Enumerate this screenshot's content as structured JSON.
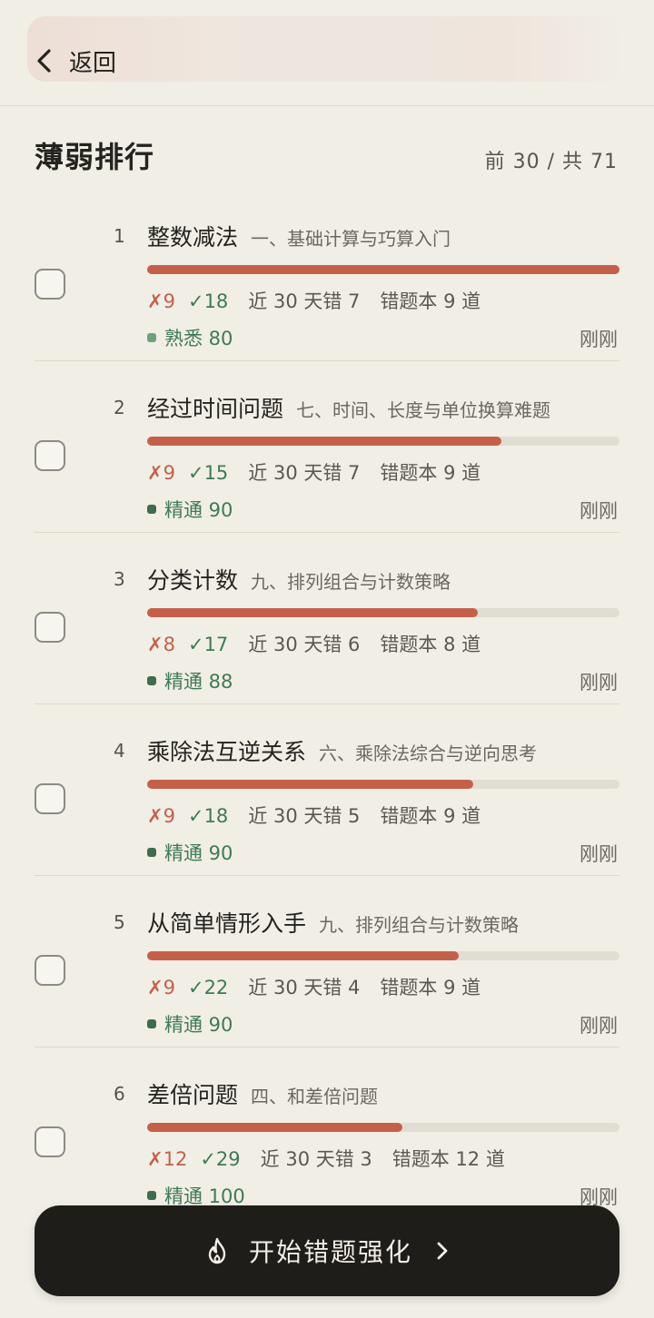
{
  "header": {
    "back_label": "返回"
  },
  "list": {
    "title": "薄弱排行",
    "count_label": "前 30 / 共 71"
  },
  "colors": {
    "accent": "#c4604a",
    "mastery_light": "#6ba37c",
    "mastery_dark": "#3f6b4f",
    "button_bg": "#1f1d1a"
  },
  "items": [
    {
      "rank": "1",
      "name": "整数减法",
      "category": "一、基础计算与巧算入门",
      "progress": 1.0,
      "wrong": "✗9",
      "right": "✓18",
      "recent": "近 30 天错 7",
      "book": "错题本 9 道",
      "mastery": "熟悉 80",
      "mastery_level": "light",
      "time": "刚刚"
    },
    {
      "rank": "2",
      "name": "经过时间问题",
      "category": "七、时间、长度与单位换算难题",
      "progress": 0.75,
      "wrong": "✗9",
      "right": "✓15",
      "recent": "近 30 天错 7",
      "book": "错题本 9 道",
      "mastery": "精通 90",
      "mastery_level": "dark",
      "time": "刚刚"
    },
    {
      "rank": "3",
      "name": "分类计数",
      "category": "九、排列组合与计数策略",
      "progress": 0.7,
      "wrong": "✗8",
      "right": "✓17",
      "recent": "近 30 天错 6",
      "book": "错题本 8 道",
      "mastery": "精通 88",
      "mastery_level": "dark",
      "time": "刚刚"
    },
    {
      "rank": "4",
      "name": "乘除法互逆关系",
      "category": "六、乘除法综合与逆向思考",
      "progress": 0.69,
      "wrong": "✗9",
      "right": "✓18",
      "recent": "近 30 天错 5",
      "book": "错题本 9 道",
      "mastery": "精通 90",
      "mastery_level": "dark",
      "time": "刚刚"
    },
    {
      "rank": "5",
      "name": "从简单情形入手",
      "category": "九、排列组合与计数策略",
      "progress": 0.66,
      "wrong": "✗9",
      "right": "✓22",
      "recent": "近 30 天错 4",
      "book": "错题本 9 道",
      "mastery": "精通 90",
      "mastery_level": "dark",
      "time": "刚刚"
    },
    {
      "rank": "6",
      "name": "差倍问题",
      "category": "四、和差倍问题",
      "progress": 0.54,
      "wrong": "✗12",
      "right": "✓29",
      "recent": "近 30 天错 3",
      "book": "错题本 12 道",
      "mastery": "精通 100",
      "mastery_level": "dark",
      "time": "刚刚"
    }
  ],
  "cta": {
    "label": "开始错题强化",
    "icon": "flame-icon"
  }
}
